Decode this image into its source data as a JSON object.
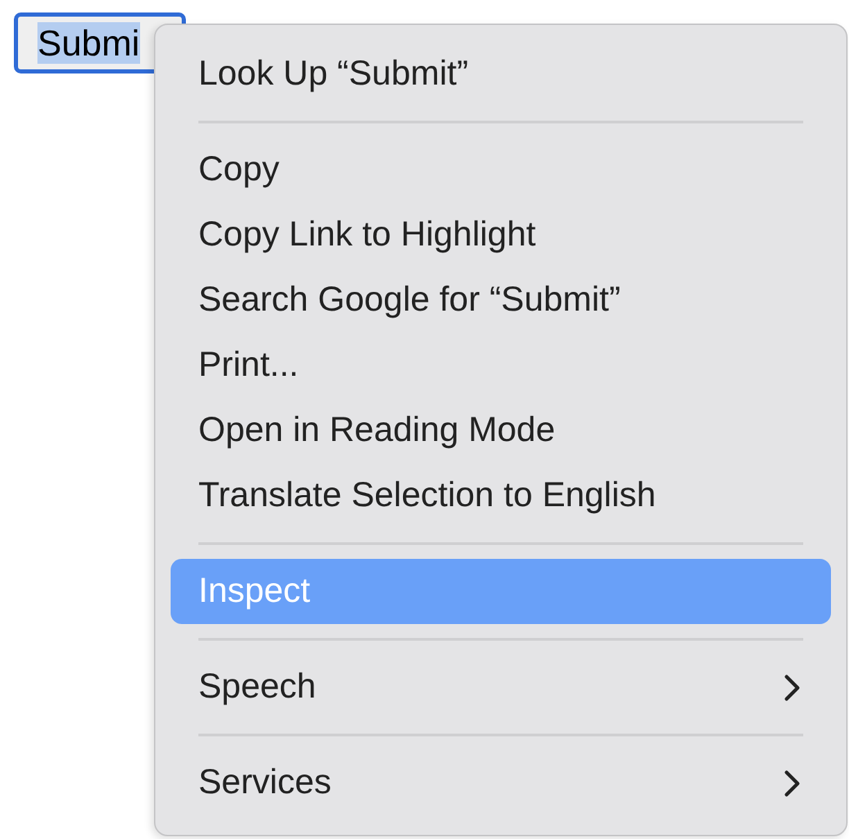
{
  "button": {
    "label": "Submi",
    "text_selected": true
  },
  "menu": {
    "items": [
      {
        "kind": "item",
        "label": "Look Up “Submit”",
        "selected": false,
        "submenu": false
      },
      {
        "kind": "separator"
      },
      {
        "kind": "item",
        "label": "Copy",
        "selected": false,
        "submenu": false
      },
      {
        "kind": "item",
        "label": "Copy Link to Highlight",
        "selected": false,
        "submenu": false
      },
      {
        "kind": "item",
        "label": "Search Google for “Submit”",
        "selected": false,
        "submenu": false
      },
      {
        "kind": "item",
        "label": "Print...",
        "selected": false,
        "submenu": false
      },
      {
        "kind": "item",
        "label": "Open in Reading Mode",
        "selected": false,
        "submenu": false
      },
      {
        "kind": "item",
        "label": "Translate Selection to English",
        "selected": false,
        "submenu": false
      },
      {
        "kind": "separator"
      },
      {
        "kind": "item",
        "label": "Inspect",
        "selected": true,
        "submenu": false
      },
      {
        "kind": "separator"
      },
      {
        "kind": "item",
        "label": "Speech",
        "selected": false,
        "submenu": true
      },
      {
        "kind": "separator"
      },
      {
        "kind": "item",
        "label": "Services",
        "selected": false,
        "submenu": true
      }
    ]
  }
}
